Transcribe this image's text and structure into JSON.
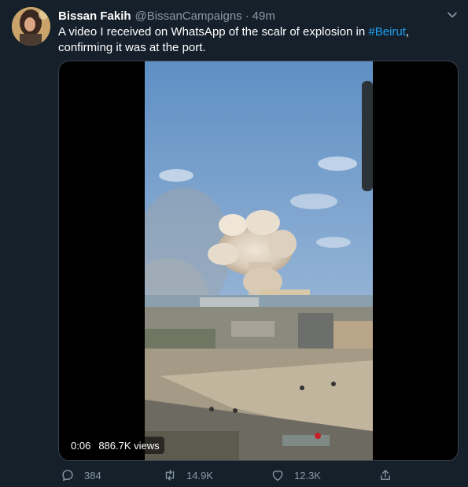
{
  "tweet": {
    "display_name": "Bissan Fakih",
    "handle": "@BissanCampaigns",
    "separator": "·",
    "time": "49m",
    "text_before": "A video I received on WhatsApp of the scalr of explosion in ",
    "hashtag": "#Beirut",
    "text_after": ", confirming it was at the port.",
    "avatar_icon": "profile-photo",
    "caret_icon": "chevron-down-icon"
  },
  "media": {
    "type": "video",
    "elapsed": "0:06",
    "views": "886.7K views"
  },
  "actions": {
    "reply_count": "384",
    "retweet_count": "14.9K",
    "like_count": "12.3K"
  },
  "colors": {
    "background": "#15202b",
    "secondary_text": "#8899a6",
    "link": "#1da1f2",
    "border": "#38444d"
  }
}
